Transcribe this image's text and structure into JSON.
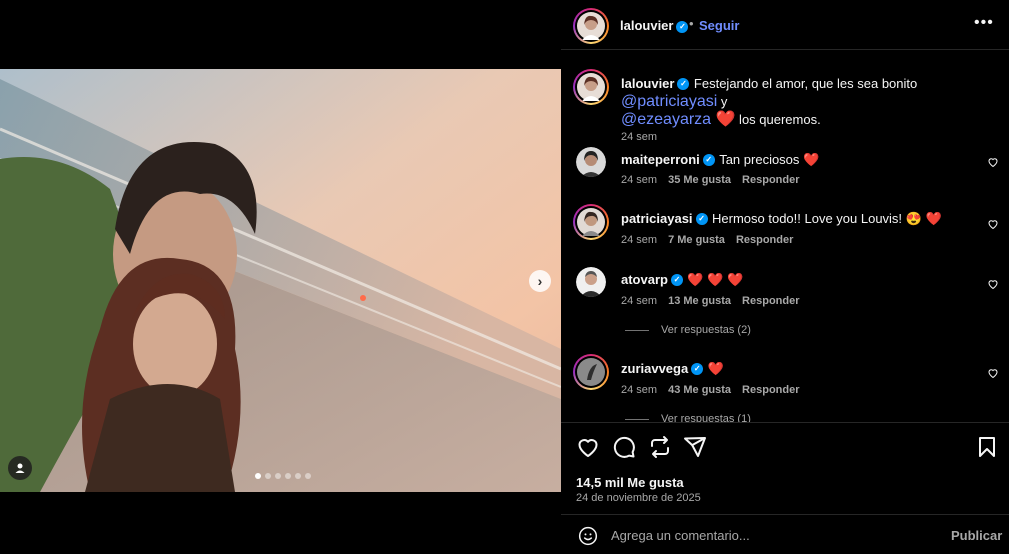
{
  "post": {
    "author": "lalouvier",
    "follow_label": "Seguir",
    "separator": "•",
    "more_icon": "more-horizontal-icon",
    "caption": {
      "username": "lalouvier",
      "text_before": "Festejando el amor, que les sea bonito ",
      "mention1": "@patriciayasi",
      "text_middle": " y",
      "mention2": "@ezeayarza",
      "heart": "❤️",
      "text_after": " los queremos.",
      "time": "24 sem"
    },
    "comments": [
      {
        "username": "maiteperroni",
        "text": "Tan preciosos ❤️",
        "time": "24 sem",
        "likes": "35 Me gusta",
        "reply": "Responder"
      },
      {
        "username": "patriciayasi",
        "text": "Hermoso todo!! Love you Louvis! 😍 ❤️",
        "time": "24 sem",
        "likes": "7 Me gusta",
        "reply": "Responder"
      },
      {
        "username": "atovarp",
        "text": "❤️ ❤️ ❤️",
        "time": "24 sem",
        "likes": "13 Me gusta",
        "reply": "Responder",
        "view_replies": "Ver respuestas (2)"
      },
      {
        "username": "zuriavvega",
        "text": "❤️",
        "time": "24 sem",
        "likes": "43 Me gusta",
        "reply": "Responder",
        "view_replies": "Ver respuestas (1)"
      }
    ],
    "likes_count": "14,5 mil Me gusta",
    "date": "24 de noviembre de 2025",
    "comment_placeholder": "Agrega un comentario...",
    "publish_label": "Publicar",
    "carousel": {
      "total": 6,
      "active": 1
    },
    "colors": {
      "accent": "#0095f6",
      "link": "#708dff",
      "heart": "#ff3040",
      "background": "#000000"
    }
  }
}
